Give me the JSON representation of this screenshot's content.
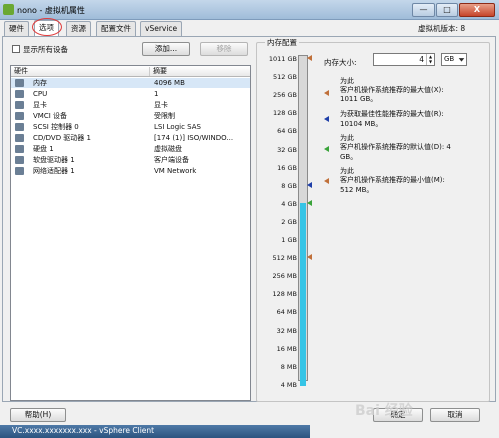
{
  "window": {
    "title": "nono - 虚拟机属性",
    "min_label": "—",
    "max_label": "□",
    "close_label": "X"
  },
  "tabs": [
    {
      "label": "硬件"
    },
    {
      "label": "选项"
    },
    {
      "label": "资源"
    },
    {
      "label": "配置文件"
    },
    {
      "label": "vService"
    }
  ],
  "active_tab": "选项",
  "version": "虚拟机版本: 8",
  "show_all_devices": {
    "label": "显示所有设备",
    "checked": false
  },
  "buttons": {
    "add": "添加...",
    "remove": "移除",
    "help": "帮助(H)",
    "ok": "确定",
    "cancel": "取消"
  },
  "hardware": {
    "header": {
      "col1": "硬件",
      "col2": "摘要"
    },
    "rows": [
      {
        "name": "内存",
        "summary": "4096 MB",
        "icon": "memory-icon",
        "selected": true
      },
      {
        "name": "CPU",
        "summary": "1",
        "icon": "cpu-icon"
      },
      {
        "name": "显卡",
        "summary": "显卡",
        "icon": "video-card-icon"
      },
      {
        "name": "VMCI 设备",
        "summary": "受限制",
        "icon": "vmci-icon"
      },
      {
        "name": "SCSI 控制器 0",
        "summary": "LSI Logic SAS",
        "icon": "scsi-controller-icon"
      },
      {
        "name": "CD/DVD 驱动器 1",
        "summary": "[174 (1)] ISO/WINDO...",
        "icon": "cd-dvd-icon"
      },
      {
        "name": "硬盘 1",
        "summary": "虚拟磁盘",
        "icon": "hard-disk-icon"
      },
      {
        "name": "软盘驱动器 1",
        "summary": "客户端设备",
        "icon": "floppy-icon"
      },
      {
        "name": "网络适配器 1",
        "summary": "VM Network",
        "icon": "network-adapter-icon"
      }
    ]
  },
  "memory": {
    "group_title": "内存配置",
    "size_label": "内存大小:",
    "size_value": "4",
    "unit": "GB",
    "spin_up": "▲",
    "spin_down": "▼",
    "scale_ticks": [
      "1011 GB",
      "512 GB",
      "256 GB",
      "128 GB",
      "64 GB",
      "32 GB",
      "16 GB",
      "8 GB",
      "4 GB",
      "2 GB",
      "1 GB",
      "512 MB",
      "256 MB",
      "128 MB",
      "64 MB",
      "32 MB",
      "16 MB",
      "8 MB",
      "4 MB"
    ],
    "current_level_gb": 4,
    "markers": [
      {
        "tick": "1011 GB",
        "color": "#c0703a"
      },
      {
        "tick": "8 GB",
        "color": "#1f3fa8"
      },
      {
        "tick": "4 GB",
        "color": "#3aa33a"
      },
      {
        "tick": "512 MB",
        "color": "#c0703a"
      }
    ],
    "notes": [
      {
        "line1": "为此",
        "line2": "客户机操作系统推荐的最大值(X):",
        "line3": "1011 GB。",
        "color": "#c0703a"
      },
      {
        "line1": "为获取最佳性能推荐的最大值(R):",
        "line2": "10104 MB。",
        "line3": "",
        "color": "#1f3fa8"
      },
      {
        "line1": "为此",
        "line2": "客户机操作系统推荐的默认值(D): 4",
        "line3": "GB。",
        "color": "#3aa33a"
      },
      {
        "line1": "为此",
        "line2": "客户机操作系统推荐的最小值(M):",
        "line3": "512 MB。",
        "color": "#c0703a"
      }
    ]
  },
  "taskbar": {
    "text": "VC.xxxx.xxxxxxx.xxx - vSphere Client"
  },
  "watermark": "Bai 经验"
}
